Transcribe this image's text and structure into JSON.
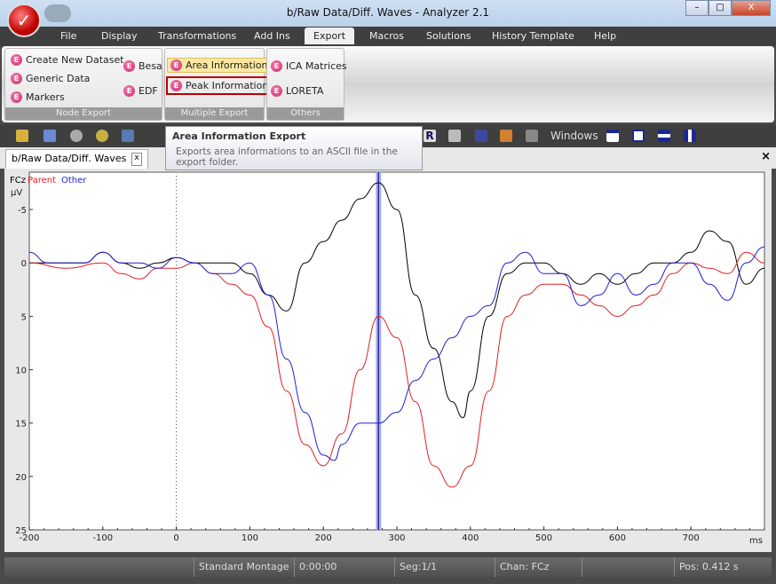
{
  "window": {
    "title": "b/Raw Data/Diff. Waves - Analyzer 2.1",
    "minimize": "–",
    "maximize": "□",
    "close": "X"
  },
  "menu": [
    "File",
    "Display",
    "Transformations",
    "Add Ins",
    "Export",
    "Macros",
    "Solutions",
    "History Template",
    "Help"
  ],
  "menu_active": "Export",
  "ribbon": {
    "node_export": {
      "label": "Node Export",
      "items": [
        "Create New Dataset",
        "Generic Data",
        "Markers",
        "Besa",
        "EDF"
      ]
    },
    "multiple_export": {
      "label": "Multiple Export",
      "items": [
        "Area Information",
        "Peak Information"
      ]
    },
    "others": {
      "label": "Others",
      "items": [
        "ICA Matrices",
        "LORETA"
      ]
    }
  },
  "toolbar": {
    "windows_label": "Windows"
  },
  "tooltip": {
    "title": "Area Information Export",
    "text": "Exports area informations to an ASCII file in the export folder."
  },
  "doc_tab": {
    "label": "b/Raw Data/Diff. Waves",
    "close": "x"
  },
  "panel_close": "×",
  "chart_data": {
    "type": "line",
    "channel": "FCz",
    "ylabel": "µV",
    "xlabel": "ms",
    "xlim": [
      -200,
      800
    ],
    "ylim": [
      25,
      -7
    ],
    "y_inverted": true,
    "xticks": [
      -200,
      -100,
      0,
      100,
      200,
      300,
      400,
      500,
      600,
      700
    ],
    "yticks": [
      -5,
      0,
      5,
      10,
      15,
      20,
      25
    ],
    "cursor_x": 275,
    "series": [
      {
        "name": "FCz",
        "color": "#000000",
        "x": [
          -200,
          -175,
          -150,
          -125,
          -100,
          -75,
          -50,
          -25,
          0,
          25,
          50,
          75,
          100,
          125,
          150,
          175,
          200,
          225,
          250,
          275,
          300,
          325,
          350,
          375,
          390,
          400,
          425,
          450,
          475,
          500,
          525,
          550,
          575,
          600,
          625,
          650,
          675,
          700,
          725,
          750,
          775,
          800
        ],
        "y": [
          0,
          0,
          0,
          0,
          -1,
          0,
          0.5,
          0,
          -0.5,
          0,
          0,
          0,
          1,
          3,
          4.5,
          0,
          -2,
          -4,
          -6,
          -7.5,
          -5,
          3,
          8,
          13,
          14.5,
          12,
          5,
          1,
          0,
          0,
          1,
          2,
          1,
          2,
          1,
          0,
          0,
          -1,
          -3,
          -2,
          2,
          0.5
        ]
      },
      {
        "name": "Parent",
        "color": "#e02020",
        "x": [
          -200,
          -150,
          -100,
          -75,
          -50,
          -25,
          0,
          25,
          50,
          75,
          100,
          125,
          150,
          175,
          200,
          225,
          250,
          275,
          300,
          325,
          350,
          375,
          400,
          425,
          450,
          475,
          500,
          525,
          550,
          575,
          600,
          625,
          650,
          675,
          700,
          725,
          750,
          775,
          800
        ],
        "y": [
          0,
          0.5,
          0,
          1,
          1.5,
          0.5,
          0.5,
          0,
          1,
          2,
          3,
          6,
          12,
          17,
          19,
          16,
          10,
          5,
          7,
          13,
          19,
          21,
          19,
          12,
          5,
          3,
          2,
          2,
          3,
          4,
          5,
          4,
          3,
          1,
          0,
          0.5,
          1,
          -1,
          0
        ]
      },
      {
        "name": "Other",
        "color": "#2020d0",
        "x": [
          -200,
          -175,
          -150,
          -125,
          -100,
          -75,
          -50,
          -25,
          0,
          25,
          50,
          75,
          100,
          125,
          150,
          175,
          200,
          215,
          225,
          250,
          275,
          300,
          325,
          350,
          375,
          400,
          425,
          450,
          475,
          500,
          525,
          550,
          575,
          600,
          625,
          650,
          675,
          700,
          725,
          750,
          775,
          800
        ],
        "y": [
          -1,
          0,
          0,
          0,
          -1,
          0,
          0,
          0.5,
          -0.5,
          0,
          1,
          1,
          0,
          3,
          9,
          14,
          18,
          18.5,
          17,
          15,
          15,
          14,
          11,
          9,
          7,
          5,
          4,
          0,
          -1,
          1,
          1,
          4,
          3,
          1,
          3,
          2,
          0,
          0,
          2,
          3.5,
          0,
          -1.5
        ]
      }
    ]
  },
  "status": {
    "montage": "Standard Montage",
    "time": "0:00:00",
    "seg": "Seg:1/1",
    "chan": "Chan:  FCz",
    "pos": "Pos:  0.412 s"
  }
}
